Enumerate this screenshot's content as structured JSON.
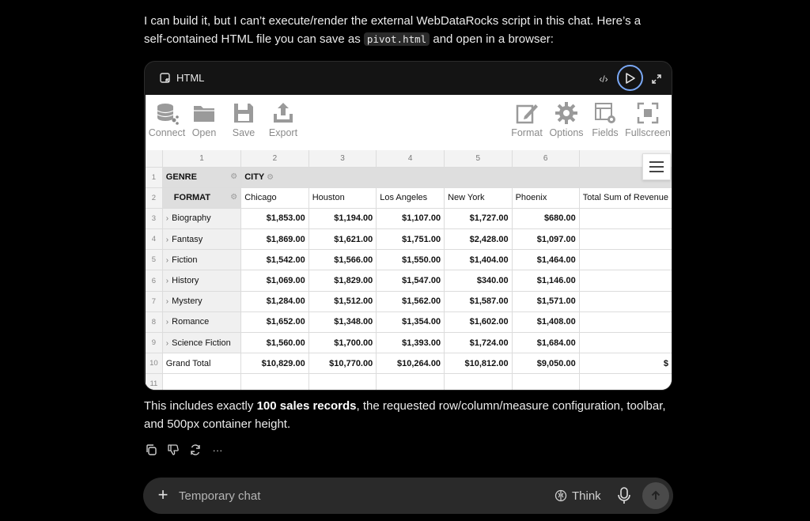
{
  "intro": {
    "text_before": "I can build it, but I can’t execute/render the external WebDataRocks script in this chat. Here’s a self-contained HTML file you can save as ",
    "filename": "pivot.html",
    "text_after": " and open in a browser:"
  },
  "code_card": {
    "language": "HTML"
  },
  "toolbar": {
    "connect": "Connect",
    "open": "Open",
    "save": "Save",
    "export": "Export",
    "format": "Format",
    "options": "Options",
    "fields": "Fields",
    "fullscreen": "Fullscreen"
  },
  "pivot": {
    "column_numbers": [
      "1",
      "2",
      "3",
      "4",
      "5",
      "6"
    ],
    "row_numbers": [
      "1",
      "2",
      "3",
      "4",
      "5",
      "6",
      "7",
      "8",
      "9",
      "10",
      "11"
    ],
    "row_field": "GENRE",
    "column_field": "CITY",
    "format_field": "FORMAT",
    "cities": [
      "Chicago",
      "Houston",
      "Los Angeles",
      "New York",
      "Phoenix",
      "Total Sum of Revenue"
    ],
    "rows": [
      {
        "label": "Biography",
        "values": [
          "$1,853.00",
          "$1,194.00",
          "$1,107.00",
          "$1,727.00",
          "$680.00"
        ]
      },
      {
        "label": "Fantasy",
        "values": [
          "$1,869.00",
          "$1,621.00",
          "$1,751.00",
          "$2,428.00",
          "$1,097.00"
        ]
      },
      {
        "label": "Fiction",
        "values": [
          "$1,542.00",
          "$1,566.00",
          "$1,550.00",
          "$1,404.00",
          "$1,464.00"
        ]
      },
      {
        "label": "History",
        "values": [
          "$1,069.00",
          "$1,829.00",
          "$1,547.00",
          "$340.00",
          "$1,146.00"
        ]
      },
      {
        "label": "Mystery",
        "values": [
          "$1,284.00",
          "$1,512.00",
          "$1,562.00",
          "$1,587.00",
          "$1,571.00"
        ]
      },
      {
        "label": "Romance",
        "values": [
          "$1,652.00",
          "$1,348.00",
          "$1,354.00",
          "$1,602.00",
          "$1,408.00"
        ]
      },
      {
        "label": "Science Fiction",
        "values": [
          "$1,560.00",
          "$1,700.00",
          "$1,393.00",
          "$1,724.00",
          "$1,684.00"
        ]
      }
    ],
    "grand_total": {
      "label": "Grand Total",
      "values": [
        "$10,829.00",
        "$10,770.00",
        "$10,264.00",
        "$10,812.00",
        "$9,050.00",
        "$"
      ]
    }
  },
  "outro": {
    "text_before": "This includes exactly ",
    "bold": "100 sales records",
    "text_after": ", the requested row/column/measure configuration, toolbar, and 500px container height."
  },
  "composer": {
    "placeholder": "Temporary chat",
    "think_label": "Think"
  }
}
